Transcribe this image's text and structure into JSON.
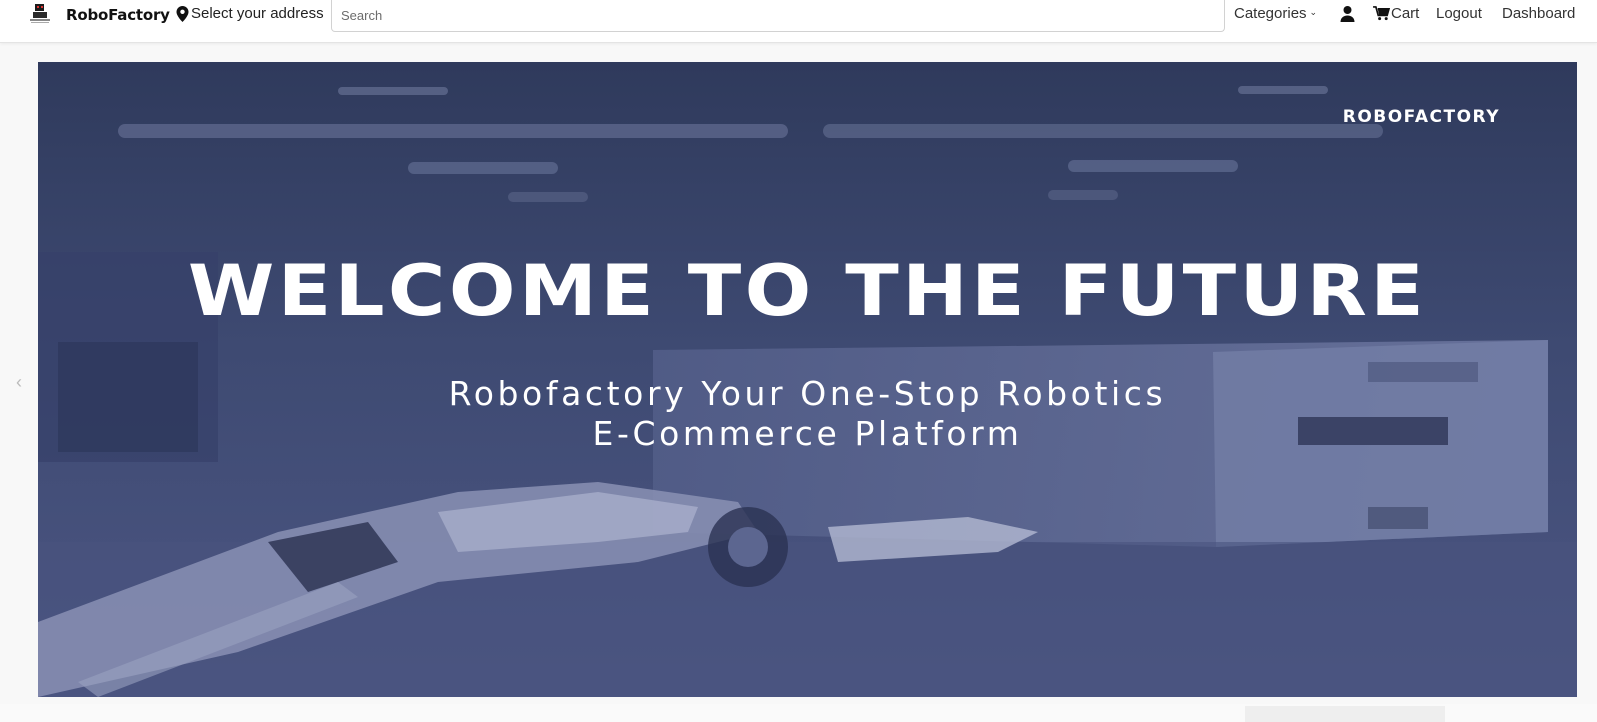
{
  "nav": {
    "brand": "RoboFactory",
    "address_label": "Select your address",
    "search_placeholder": "Search",
    "categories_label": "Categories",
    "cart_label": "Cart",
    "logout_label": "Logout",
    "dashboard_label": "Dashboard"
  },
  "hero": {
    "brand": "ROBOFACTORY",
    "title": "WELCOME TO THE FUTURE",
    "subtitle_line1": "Robofactory Your One-Stop Robotics",
    "subtitle_line2": "E-Commerce Platform"
  },
  "icons": {
    "logo": "robot-logo-icon",
    "address": "map-pin-icon",
    "categories": "chevron-down-icon",
    "user": "user-icon",
    "cart": "cart-icon"
  },
  "colors": {
    "hero_overlay": "#3c4568",
    "navbar_bg": "#ffffff",
    "text_dark": "#333333"
  }
}
